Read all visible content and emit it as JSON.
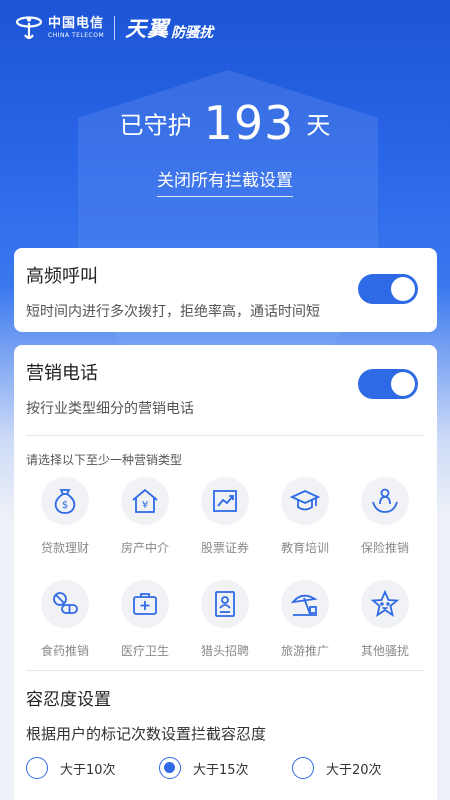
{
  "brand": {
    "carrier_name": "中国电信",
    "carrier_name_en": "CHINA TELECOM",
    "product_name": "天翼",
    "product_suffix": "防骚扰"
  },
  "guard": {
    "prefix": "已守护",
    "days": "193",
    "suffix": "天"
  },
  "close_all_label": "关闭所有拦截设置",
  "high_freq": {
    "title": "高频呼叫",
    "description": "短时间内进行多次拨打，拒绝率高，通话时间短",
    "enabled": true
  },
  "marketing": {
    "title": "营销电话",
    "description": "按行业类型细分的营销电话",
    "enabled": true,
    "hint": "请选择以下至少一种营销类型",
    "categories": [
      {
        "label": "贷款理财",
        "icon": "money-bag-icon"
      },
      {
        "label": "房产中介",
        "icon": "house-icon"
      },
      {
        "label": "股票证券",
        "icon": "stock-chart-icon"
      },
      {
        "label": "教育培训",
        "icon": "graduation-cap-icon"
      },
      {
        "label": "保险推销",
        "icon": "insurance-hands-icon"
      },
      {
        "label": "食药推销",
        "icon": "pills-icon"
      },
      {
        "label": "医疗卫生",
        "icon": "medical-kit-icon"
      },
      {
        "label": "猎头招聘",
        "icon": "resume-icon"
      },
      {
        "label": "旅游推广",
        "icon": "beach-umbrella-icon"
      },
      {
        "label": "其他骚扰",
        "icon": "star-icon"
      }
    ]
  },
  "tolerance": {
    "title": "容忍度设置",
    "description": "根据用户的标记次数设置拦截容忍度",
    "options": [
      "大于10次",
      "大于15次",
      "大于20次"
    ],
    "selected": "大于15次"
  },
  "colors": {
    "accent": "#2f6ae6",
    "hero_top": "#1c54d6"
  }
}
